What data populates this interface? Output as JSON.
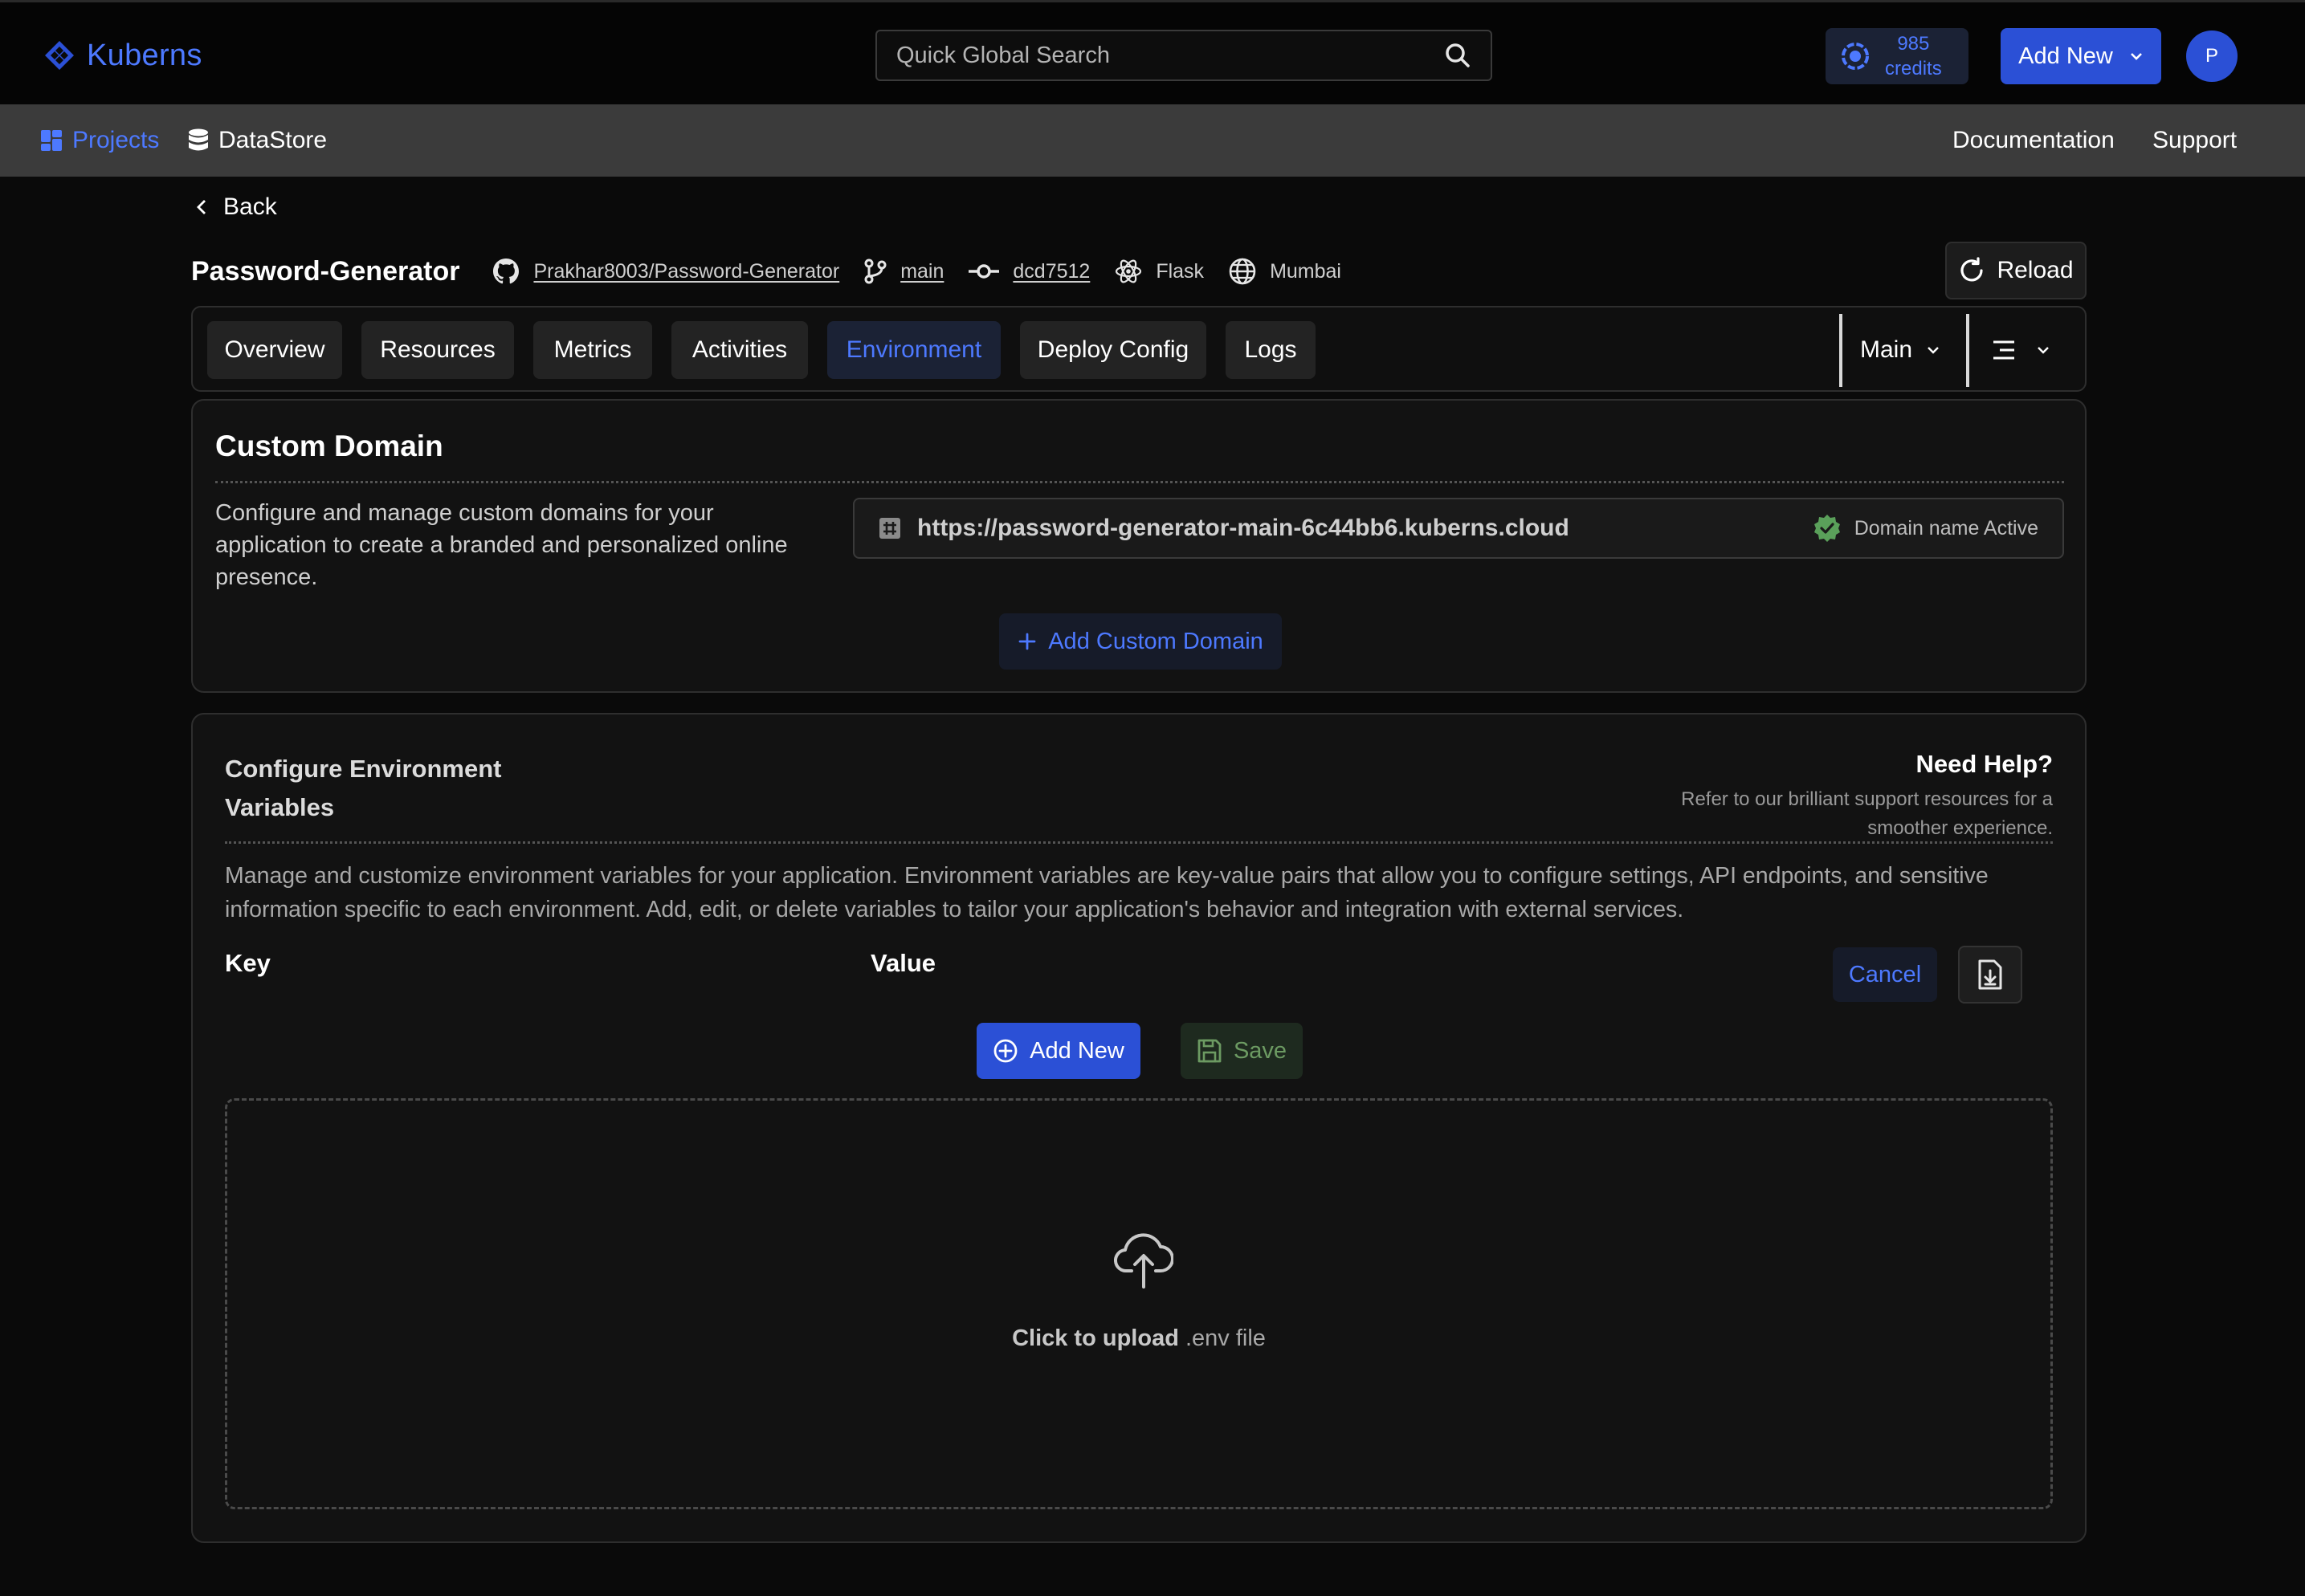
{
  "header": {
    "brand": "Kuberns",
    "search_placeholder": "Quick Global Search",
    "credits_amount": "985",
    "credits_label": "credits",
    "add_new_label": "Add New",
    "avatar_initial": "P"
  },
  "nav": {
    "projects": "Projects",
    "datastore": "DataStore",
    "documentation": "Documentation",
    "support": "Support"
  },
  "back_label": "Back",
  "project": {
    "name": "Password-Generator",
    "repo": "Prakhar8003/Password-Generator",
    "branch": "main",
    "commit": "dcd7512",
    "framework": "Flask",
    "region": "Mumbai",
    "reload_label": "Reload"
  },
  "tabs": [
    "Overview",
    "Resources",
    "Metrics",
    "Activities",
    "Environment",
    "Deploy Config",
    "Logs"
  ],
  "active_tab": "Environment",
  "environment_select": "Main",
  "custom_domain": {
    "title": "Custom Domain",
    "description": "Configure and manage custom domains for your application to create a branded and personalized online presence.",
    "url": "https://password-generator-main-6c44bb6.kuberns.cloud",
    "status": "Domain name Active",
    "add_label": "Add Custom Domain"
  },
  "env": {
    "title": "Configure Environment Variables",
    "help_title": "Need Help?",
    "help_text": "Refer to our brilliant support resources for a smoother experience.",
    "description": "Manage and customize environment variables for your application. Environment variables are key-value pairs that allow you to configure settings, API endpoints, and sensitive information specific to each environment. Add, edit, or delete variables to tailor your application's behavior and integration with external services.",
    "key_header": "Key",
    "value_header": "Value",
    "cancel_label": "Cancel",
    "add_new_label": "Add New",
    "save_label": "Save",
    "upload_strong": "Click to upload",
    "upload_rest": ".env file"
  },
  "colors": {
    "accent": "#2b50d6",
    "accent_text": "#4d79ff",
    "success": "#5aa05a"
  }
}
